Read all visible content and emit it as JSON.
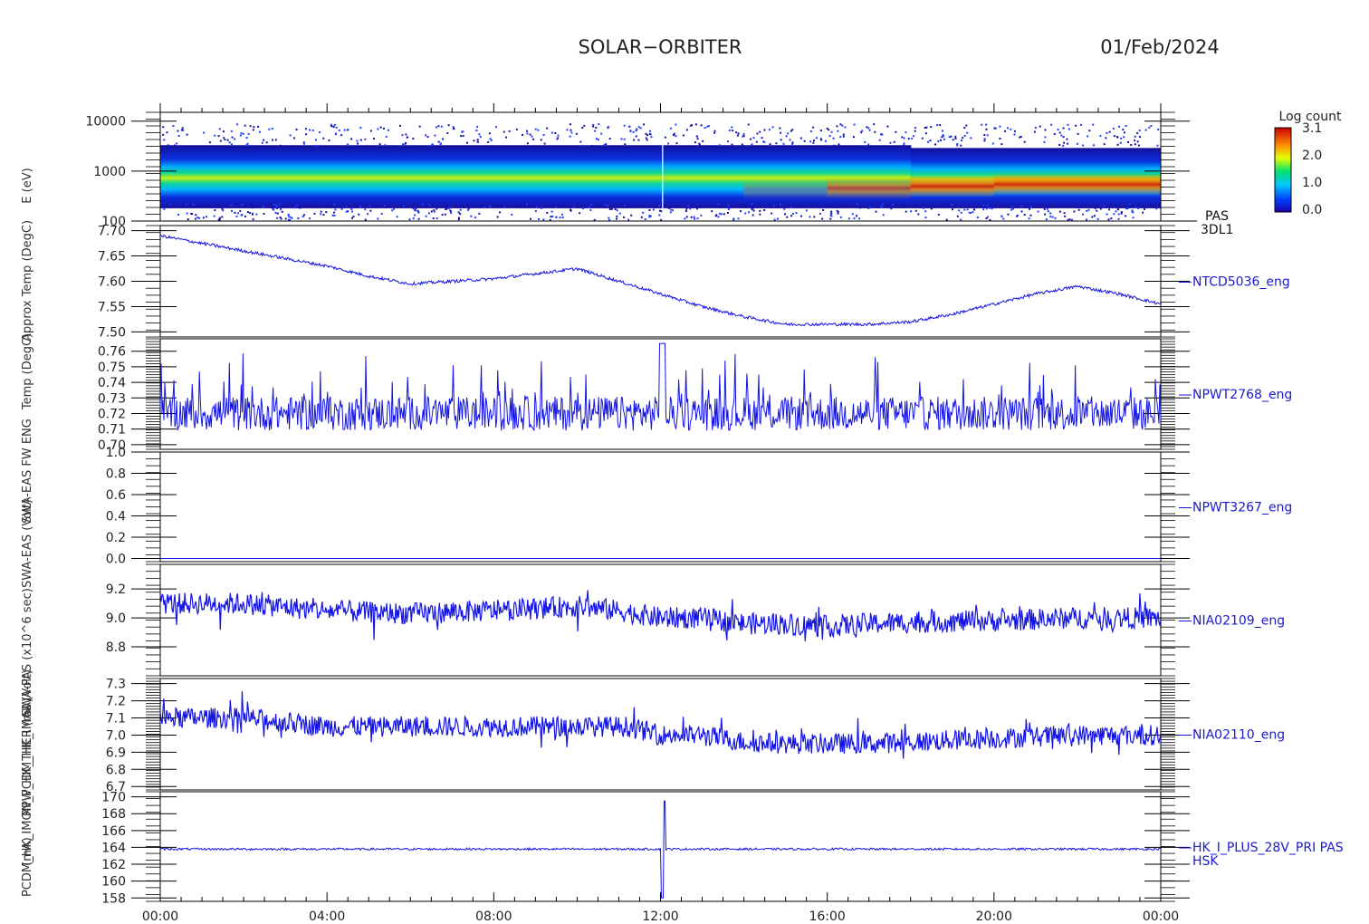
{
  "header": {
    "mission": "SOLAR−ORBITER",
    "date": "01/Feb/2024"
  },
  "colorbar": {
    "title": "Log count",
    "ticks": [
      "3.1",
      "2.0",
      "1.0",
      "0.0"
    ],
    "max": 3.1,
    "min": 0.0
  },
  "chart_data": [
    {
      "type": "heatmap",
      "name": "PAS 3DL1 energy spectrogram",
      "ylabel": "E (eV)",
      "yscale": "log",
      "ylim": [
        100,
        15000
      ],
      "yticks": [
        "10000",
        "1000",
        "100"
      ],
      "label_lines": [
        "PAS",
        "3DL1"
      ],
      "x_hours": [
        0,
        2,
        4,
        6,
        8,
        10,
        12,
        14,
        16,
        18,
        20,
        22,
        24
      ],
      "core_energy_ev": [
        480,
        470,
        460,
        450,
        450,
        445,
        440,
        430,
        440,
        470,
        520,
        560,
        520
      ],
      "core_intensity": [
        2.0,
        2.0,
        2.0,
        2.0,
        2.05,
        2.1,
        2.2,
        2.4,
        2.6,
        2.95,
        2.9,
        3.0,
        2.8
      ]
    },
    {
      "type": "line",
      "name": "NTCD5036_eng",
      "ylabel": "Temp (DegC)",
      "ylim": [
        7.49,
        7.71
      ],
      "yticks": [
        "7.70",
        "7.65",
        "7.60",
        "7.55",
        "7.50"
      ],
      "x_hours": [
        0,
        1,
        2,
        3,
        4,
        5,
        6,
        7,
        8,
        9,
        10,
        11,
        12,
        13,
        14,
        15,
        16,
        17,
        18,
        19,
        20,
        21,
        22,
        23,
        24
      ],
      "values": [
        7.69,
        7.675,
        7.66,
        7.645,
        7.63,
        7.61,
        7.595,
        7.6,
        7.605,
        7.615,
        7.625,
        7.6,
        7.575,
        7.55,
        7.53,
        7.515,
        7.515,
        7.515,
        7.52,
        7.535,
        7.555,
        7.575,
        7.59,
        7.575,
        7.555
      ]
    },
    {
      "type": "line",
      "name": "NPWT2768_eng",
      "ylabel": "SWA-EAS",
      "ylim": [
        0.697,
        0.768
      ],
      "yticks": [
        "0.76",
        "0.75",
        "0.74",
        "0.73",
        "0.72",
        "0.71",
        "0.70"
      ],
      "baseline": 0.72,
      "range": [
        0.705,
        0.765
      ]
    },
    {
      "type": "line",
      "name": "NPWT3267_eng",
      "ylabel": "SWA-PAS",
      "ylim": [
        -0.03,
        1.0
      ],
      "yticks": [
        "1.0",
        "0.8",
        "0.6",
        "0.4",
        "0.2",
        "0.0"
      ],
      "baseline": 0.0
    },
    {
      "type": "line",
      "name": "NIA02109_eng",
      "ylabel": "RPW_HK",
      "ylim": [
        8.6,
        9.37
      ],
      "yticks": [
        "9.2",
        "9.0",
        "8.8"
      ],
      "x_hours": [
        0,
        2,
        4,
        6,
        8,
        10,
        11,
        12,
        13,
        14,
        15,
        16,
        17,
        18,
        20,
        22,
        24
      ],
      "values": [
        9.1,
        9.1,
        9.05,
        9.03,
        9.05,
        9.08,
        9.05,
        9.0,
        9.0,
        8.96,
        8.96,
        8.94,
        8.96,
        8.97,
        8.98,
        9.0,
        9.0
      ]
    },
    {
      "type": "line",
      "name": "NIA02110_eng",
      "ylabel": "THERMAL",
      "ylim": [
        6.68,
        7.33
      ],
      "yticks": [
        "7.3",
        "7.2",
        "7.1",
        "7.0",
        "6.9",
        "6.8",
        "6.7"
      ],
      "x_hours": [
        0,
        2,
        4,
        6,
        8,
        10,
        11.2,
        12,
        13,
        14,
        15,
        16,
        17,
        18,
        20,
        22,
        24
      ],
      "values": [
        7.1,
        7.1,
        7.05,
        7.05,
        7.05,
        7.05,
        7.05,
        7.0,
        7.0,
        6.96,
        6.95,
        6.95,
        6.95,
        6.96,
        6.98,
        7.0,
        7.0
      ]
    },
    {
      "type": "line",
      "name": "HK_I_PLUS_28V_PRI PAS HSK",
      "label_lines": [
        "HK_I_PLUS_28V_PRI PAS",
        "HSK"
      ],
      "ylabel": "(mA)",
      "ylim": [
        157.6,
        170.6
      ],
      "yticks": [
        "170",
        "168",
        "166",
        "164",
        "162",
        "160",
        "158"
      ],
      "baseline": 163.8,
      "spike_hour": 12.05,
      "spike_min": 158.0,
      "spike_max": 169.5
    }
  ],
  "xaxis": {
    "ticks": [
      "00:00",
      "04:00",
      "08:00",
      "12:00",
      "16:00",
      "20:00",
      "00:00"
    ]
  },
  "left_labels": [
    "(mA)",
    "PCDM_HK_IMON_PCDM_HK_I (mA)",
    "RPW_HK_THERMAL (Volt)",
    "SWA-PAS (x10^6 sec)",
    "SWA-EAS (Volt)",
    "SWA-EAS FW ENG",
    "Temp (DegC)",
    "Approx Temp (DegC)",
    "E (eV)"
  ]
}
